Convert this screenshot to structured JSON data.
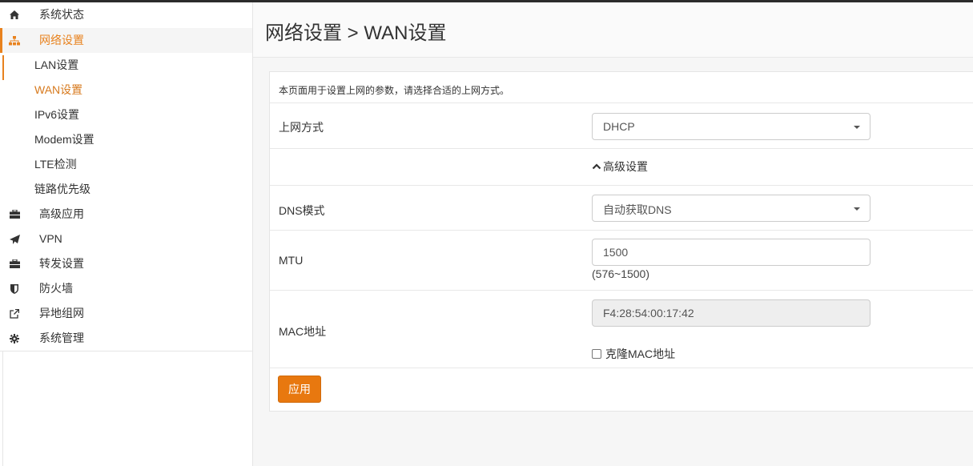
{
  "sidebar": {
    "items": [
      {
        "label": "系统状态",
        "icon": "home-icon"
      },
      {
        "label": "网络设置",
        "icon": "sitemap-icon"
      },
      {
        "label": "高级应用",
        "icon": "briefcase-icon"
      },
      {
        "label": "VPN",
        "icon": "paper-plane-icon"
      },
      {
        "label": "转发设置",
        "icon": "briefcase-icon"
      },
      {
        "label": "防火墙",
        "icon": "shield-icon"
      },
      {
        "label": "异地组网",
        "icon": "external-link-icon"
      },
      {
        "label": "系统管理",
        "icon": "gear-icon"
      }
    ],
    "subitems": [
      {
        "label": "LAN设置"
      },
      {
        "label": "WAN设置"
      },
      {
        "label": "IPv6设置"
      },
      {
        "label": "Modem设置"
      },
      {
        "label": "LTE检测"
      },
      {
        "label": "链路优先级"
      }
    ]
  },
  "header": {
    "title": "网络设置 > WAN设置"
  },
  "form": {
    "description": "本页面用于设置上网的参数，请选择合适的上网方式。",
    "connection": {
      "label": "上网方式",
      "value": "DHCP"
    },
    "advanced_label": "高级设置",
    "dns": {
      "label": "DNS模式",
      "value": "自动获取DNS"
    },
    "mtu": {
      "label": "MTU",
      "value": "1500",
      "hint": "(576~1500)"
    },
    "mac": {
      "label": "MAC地址",
      "value": "F4:28:54:00:17:42",
      "clone_label": "克隆MAC地址"
    },
    "apply_label": "应用"
  },
  "colors": {
    "accent": "#e8821e",
    "button": "#e8780f"
  }
}
